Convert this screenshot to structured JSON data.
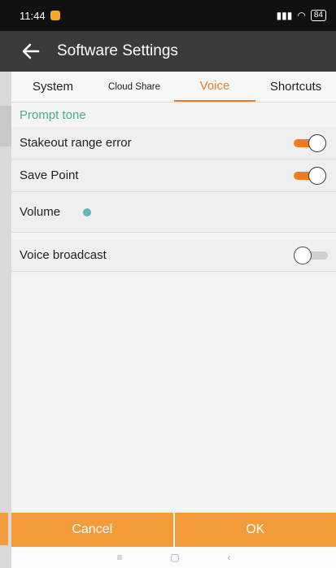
{
  "status_bar": {
    "time": "11:44",
    "battery": "84"
  },
  "appbar": {
    "title": "Software Settings"
  },
  "tabs": [
    {
      "label": "System"
    },
    {
      "label": "Cloud Share"
    },
    {
      "label": "Voice"
    },
    {
      "label": "Shortcuts"
    }
  ],
  "active_tab": "Voice",
  "section": {
    "title": "Prompt tone"
  },
  "settings": {
    "stakeout": {
      "label": "Stakeout range error",
      "enabled": true
    },
    "save_point": {
      "label": "Save Point",
      "enabled": true
    },
    "volume": {
      "label": "Volume",
      "level": 0
    },
    "voice_broadcast": {
      "label": "Voice broadcast",
      "enabled": false
    }
  },
  "buttons": {
    "cancel": "Cancel",
    "ok": "OK"
  },
  "colors": {
    "accent": "#f07c20",
    "section": "#4cae8c",
    "slider": "#5fb8b5",
    "button": "#f39a3a"
  }
}
